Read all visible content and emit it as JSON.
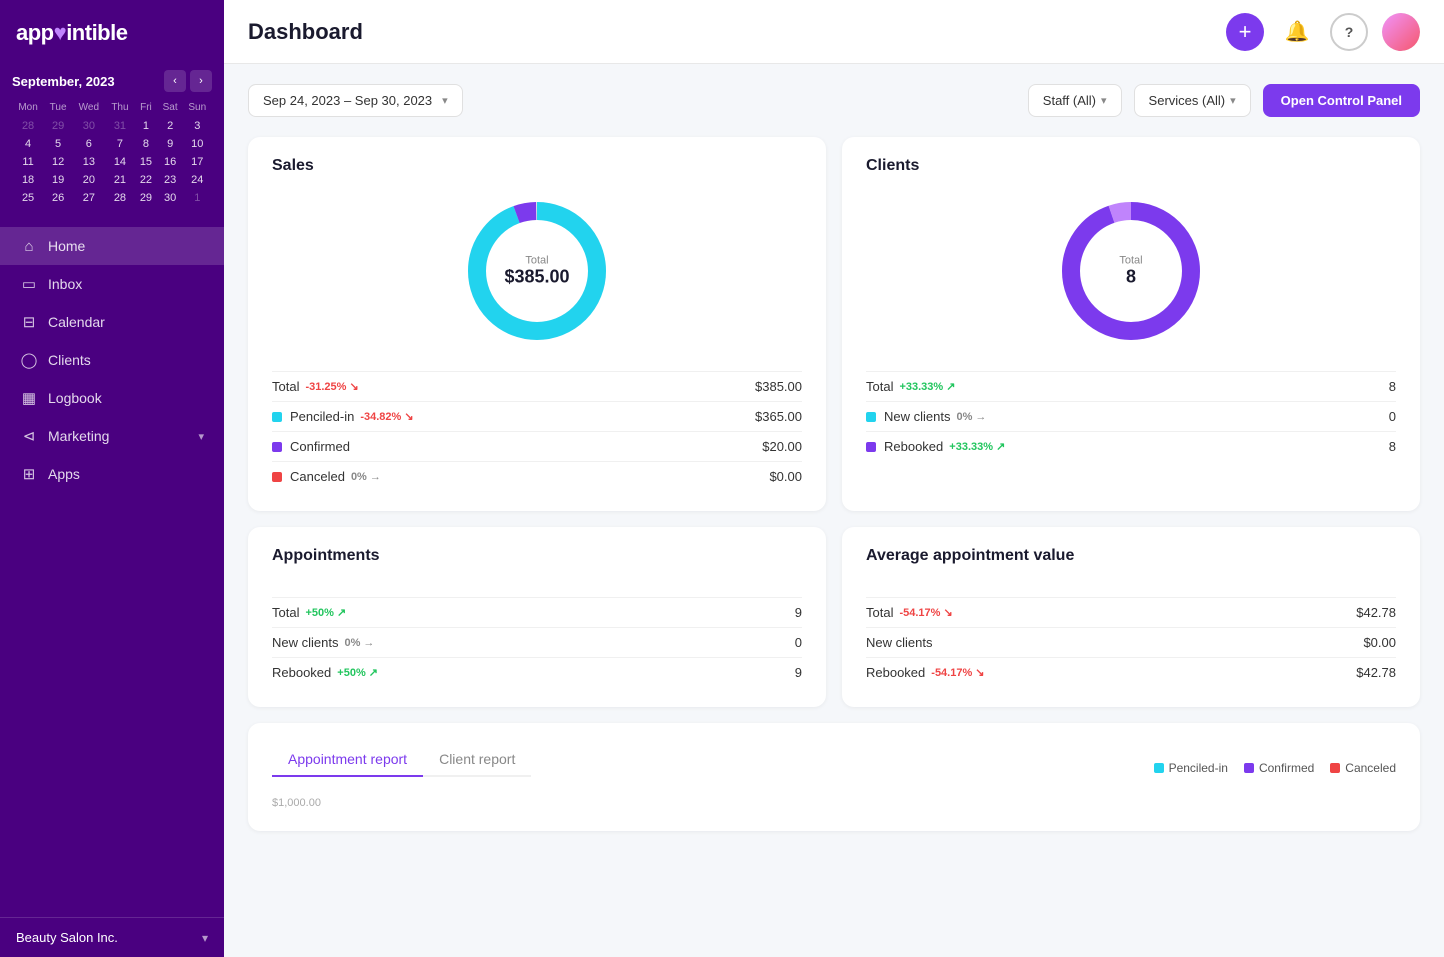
{
  "logo": {
    "text": "app",
    "dot": "♥",
    "text2": "intible"
  },
  "calendar": {
    "month": "September, 2023",
    "weekdays": [
      "Mon",
      "Tue",
      "Wed",
      "Thu",
      "Fri",
      "Sat",
      "Sun"
    ],
    "weeks": [
      [
        "28",
        "29",
        "30",
        "31",
        "1",
        "2",
        "3"
      ],
      [
        "4",
        "5",
        "6",
        "7",
        "8",
        "9",
        "10"
      ],
      [
        "11",
        "12",
        "13",
        "14",
        "15",
        "16",
        "17"
      ],
      [
        "18",
        "19",
        "20",
        "21",
        "22",
        "23",
        "24"
      ],
      [
        "25",
        "26",
        "27",
        "28",
        "29",
        "30",
        "1"
      ]
    ],
    "otherMonth": [
      "28",
      "29",
      "30",
      "31",
      "1"
    ],
    "today": "28",
    "todayWeek": 4,
    "todayCol": 3
  },
  "nav": {
    "items": [
      {
        "id": "home",
        "label": "Home",
        "icon": "🏠",
        "active": true
      },
      {
        "id": "inbox",
        "label": "Inbox",
        "icon": "📋",
        "active": false
      },
      {
        "id": "calendar",
        "label": "Calendar",
        "icon": "📅",
        "active": false
      },
      {
        "id": "clients",
        "label": "Clients",
        "icon": "👤",
        "active": false
      },
      {
        "id": "logbook",
        "label": "Logbook",
        "icon": "📒",
        "active": false
      },
      {
        "id": "marketing",
        "label": "Marketing",
        "icon": "📢",
        "active": false,
        "hasArrow": true
      },
      {
        "id": "apps",
        "label": "Apps",
        "icon": "⊞",
        "active": false
      }
    ]
  },
  "business": {
    "name": "Beauty Salon Inc."
  },
  "header": {
    "title": "Dashboard",
    "addBtn": "+",
    "bellIcon": "🔔",
    "helpIcon": "?"
  },
  "filterBar": {
    "dateRange": "Sep 24, 2023 – Sep 30, 2023",
    "staff": "Staff (All)",
    "services": "Services (All)",
    "openPanel": "Open Control Panel"
  },
  "sales": {
    "title": "Sales",
    "chartTotal": "Total",
    "chartValue": "$385.00",
    "stats": [
      {
        "label": "Total",
        "change": "-31.25%",
        "direction": "down",
        "value": "$385.00",
        "color": null
      },
      {
        "label": "Penciled-in",
        "change": "-34.82%",
        "direction": "down",
        "value": "$365.00",
        "color": "#22d3ee"
      },
      {
        "label": "Confirmed",
        "change": "",
        "direction": "none",
        "value": "$20.00",
        "color": "#7c3aed"
      },
      {
        "label": "Canceled",
        "change": "0%",
        "direction": "neutral",
        "value": "$0.00",
        "color": "#ef4444"
      }
    ]
  },
  "clients": {
    "title": "Clients",
    "chartTotal": "Total",
    "chartValue": "8",
    "stats": [
      {
        "label": "Total",
        "change": "+33.33%",
        "direction": "up",
        "value": "8",
        "color": null
      },
      {
        "label": "New clients",
        "change": "0%",
        "direction": "neutral",
        "value": "0",
        "color": "#22d3ee"
      },
      {
        "label": "Rebooked",
        "change": "+33.33%",
        "direction": "up",
        "value": "8",
        "color": "#7c3aed"
      }
    ]
  },
  "appointments": {
    "title": "Appointments",
    "stats": [
      {
        "label": "Total",
        "change": "+50%",
        "direction": "up",
        "value": "9"
      },
      {
        "label": "New clients",
        "change": "0%",
        "direction": "neutral",
        "value": "0"
      },
      {
        "label": "Rebooked",
        "change": "+50%",
        "direction": "up",
        "value": "9"
      }
    ]
  },
  "avgValue": {
    "title": "Average appointment value",
    "stats": [
      {
        "label": "Total",
        "change": "-54.17%",
        "direction": "down",
        "value": "$42.78"
      },
      {
        "label": "New clients",
        "change": "",
        "direction": "none",
        "value": "$0.00"
      },
      {
        "label": "Rebooked",
        "change": "-54.17%",
        "direction": "down",
        "value": "$42.78"
      }
    ]
  },
  "report": {
    "tabs": [
      "Appointment report",
      "Client report"
    ],
    "activeTab": 0,
    "legend": [
      {
        "label": "Penciled-in",
        "color": "#22d3ee"
      },
      {
        "label": "Confirmed",
        "color": "#7c3aed"
      },
      {
        "label": "Canceled",
        "color": "#ef4444"
      }
    ],
    "yLabel": "$1,000.00"
  }
}
